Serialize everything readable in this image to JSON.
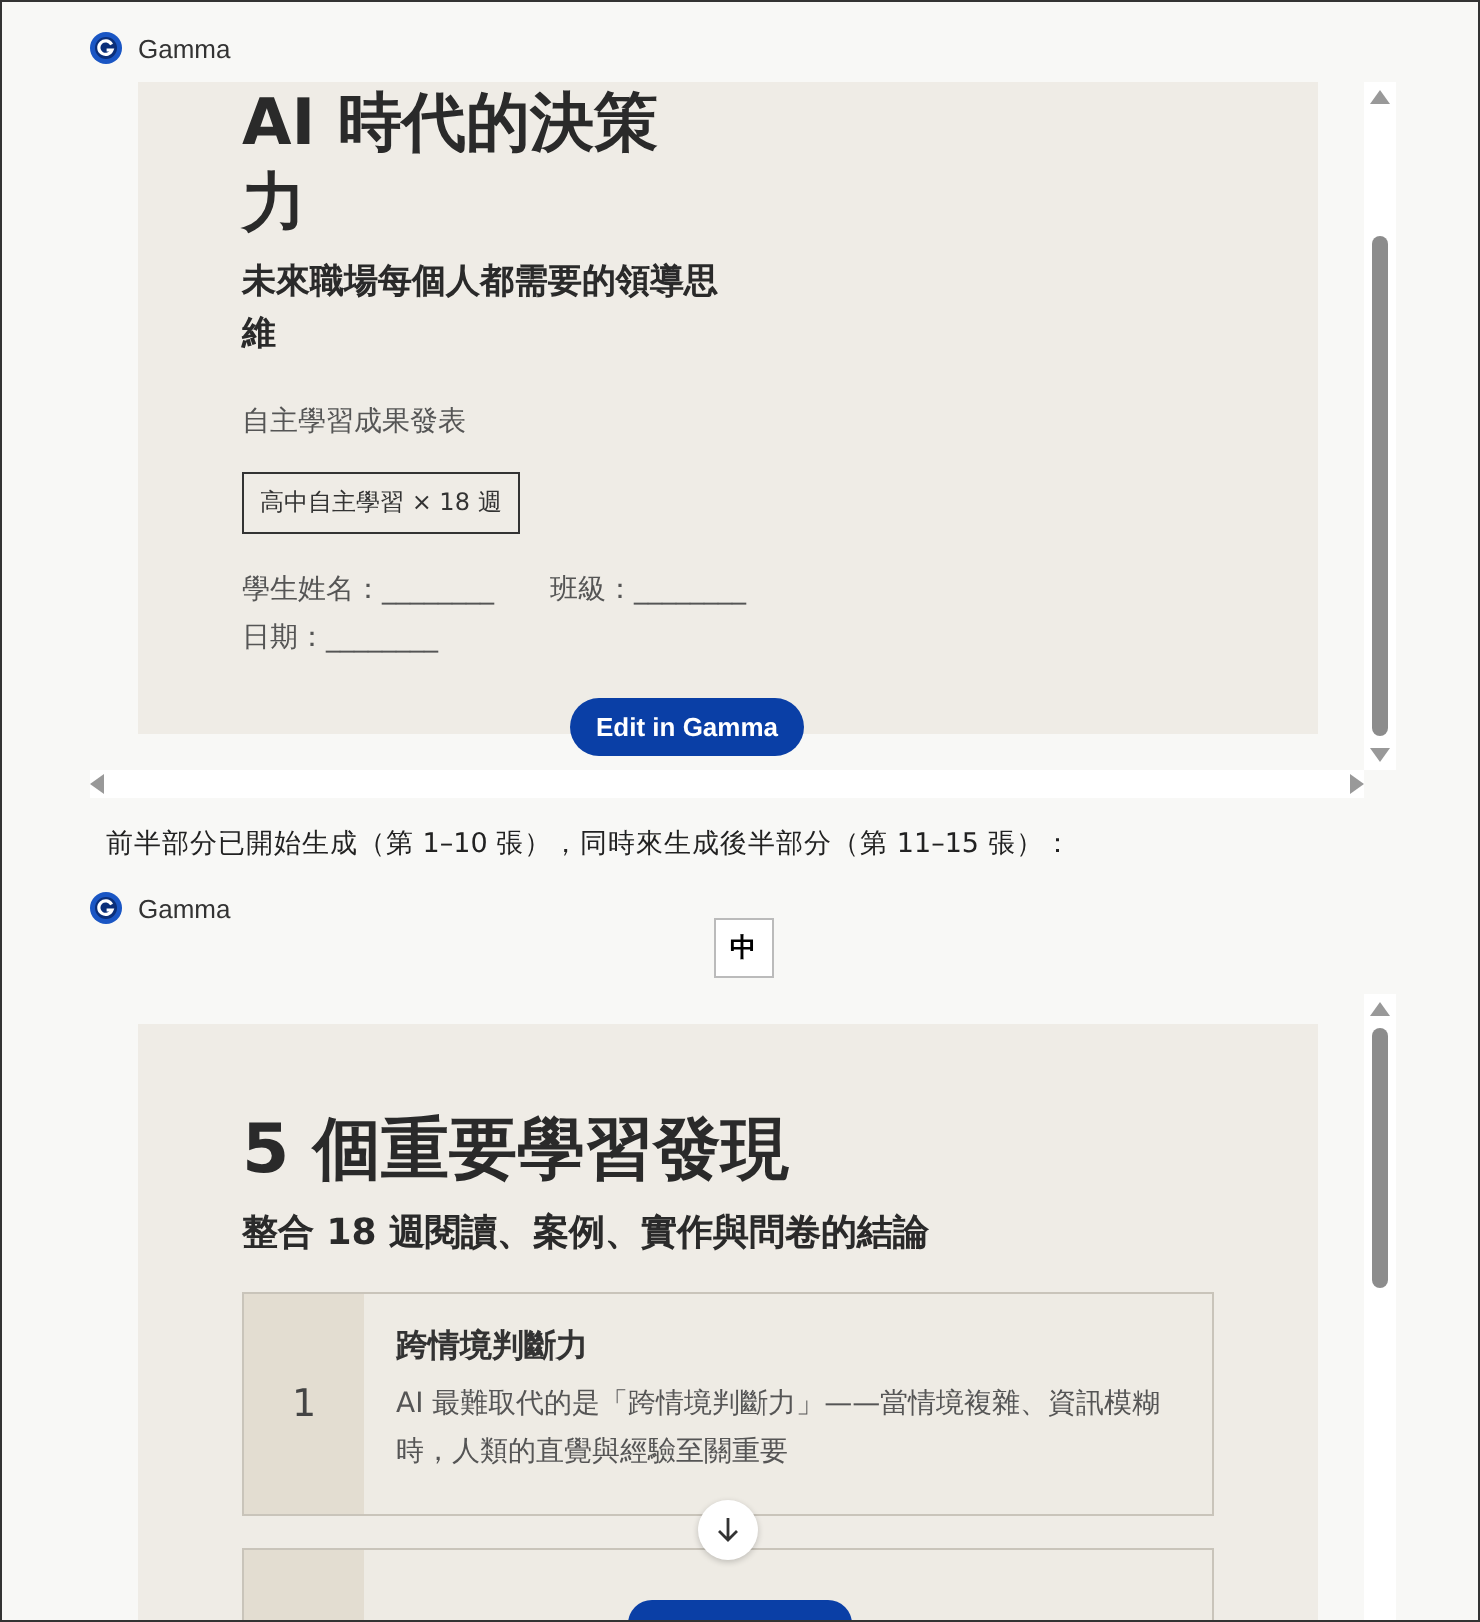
{
  "embeds": [
    {
      "brand": "Gamma",
      "slide": {
        "kind": "title",
        "title": "AI 時代的決策力",
        "subtitle": "未來職場每個人都需要的領導思維",
        "tagline": "自主學習成果發表",
        "badge": "高中自主學習 × 18 週",
        "fields_line": "學生姓名：________　　班級：________　　日期：________"
      },
      "edit_button": "Edit in Gamma"
    },
    {
      "brand": "Gamma",
      "lang_toggle": "中",
      "slide": {
        "kind": "list",
        "title": "5 個重要學習發現",
        "subtitle": "整合 18 週閱讀、案例、實作與問卷的結論",
        "items": [
          {
            "number": "1",
            "heading": "跨情境判斷力",
            "body": "AI 最難取代的是「跨情境判斷力」——當情境複雜、資訊模糊時，人類的直覺與經驗至關重要"
          }
        ]
      }
    }
  ],
  "message": "前半部分已開始生成（第 1–10 張），同時來生成後半部分（第 11–15 張）："
}
